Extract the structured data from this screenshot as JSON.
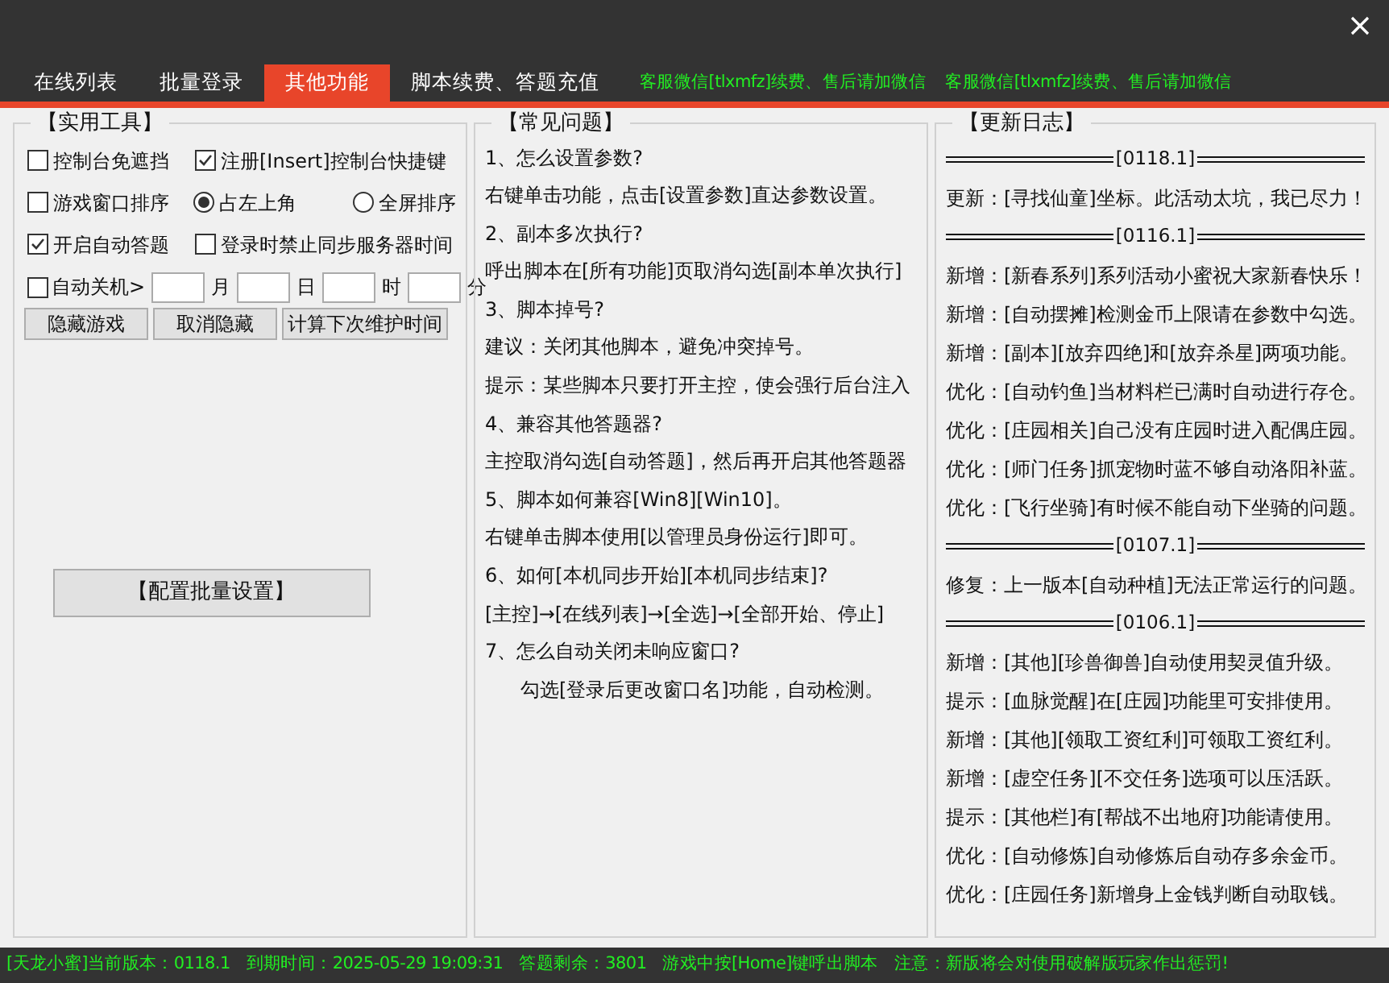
{
  "tabs": [
    {
      "label": "在线列表",
      "selected": false
    },
    {
      "label": "批量登录",
      "selected": false
    },
    {
      "label": "其他功能",
      "selected": true
    },
    {
      "label": "脚本续费、答题充值",
      "selected": false
    }
  ],
  "header_notes": [
    "客服微信[tlxmfz]续费、售后请加微信",
    "客服微信[tlxmfz]续费、售后请加微信"
  ],
  "tools": {
    "title": "【实用工具】",
    "options": [
      {
        "kind": "checkbox",
        "label": "控制台免遮挡",
        "checked": false
      },
      {
        "kind": "checkbox",
        "label": "注册[Insert]控制台快捷键",
        "checked": true
      },
      {
        "kind": "checkbox",
        "label": "游戏窗口排序",
        "checked": false
      },
      {
        "kind": "radio",
        "label": "占左上角",
        "selected": true
      },
      {
        "kind": "radio",
        "label": "全屏排序",
        "selected": false
      },
      {
        "kind": "checkbox",
        "label": "开启自动答题",
        "checked": true
      },
      {
        "kind": "checkbox",
        "label": "登录时禁止同步服务器时间",
        "checked": false
      }
    ],
    "shutdown": {
      "label": "自动关机>",
      "checked": false,
      "units": [
        "月",
        "日",
        "时",
        "分"
      ]
    },
    "buttons": [
      "隐藏游戏",
      "取消隐藏",
      "计算下次维护时间"
    ],
    "config_button": "【配置批量设置】"
  },
  "faq": {
    "title": "【常见问题】",
    "lines": [
      {
        "kind": "question",
        "text": "1、怎么设置参数?"
      },
      {
        "kind": "answer",
        "text": "右键单击功能，点击[设置参数]直达参数设置。"
      },
      {
        "kind": "question",
        "text": "2、副本多次执行?"
      },
      {
        "kind": "answer",
        "text": "呼出脚本在[所有功能]页取消勾选[副本单次执行]"
      },
      {
        "kind": "question",
        "text": "3、脚本掉号?"
      },
      {
        "kind": "answer",
        "text": "建议：关闭其他脚本，避免冲突掉号。"
      },
      {
        "kind": "answer",
        "text": "提示：某些脚本只要打开主控，使会强行后台注入"
      },
      {
        "kind": "question",
        "text": "4、兼容其他答题器?"
      },
      {
        "kind": "answer",
        "text": "主控取消勾选[自动答题]，然后再开启其他答题器"
      },
      {
        "kind": "question",
        "text": "5、脚本如何兼容[Win8][Win10]。"
      },
      {
        "kind": "answer",
        "text": "右键单击脚本使用[以管理员身份运行]即可。"
      },
      {
        "kind": "question",
        "text": "6、如何[本机同步开始][本机同步结束]?"
      },
      {
        "kind": "answer",
        "text": "[主控]→[在线列表]→[全选]→[全部开始、停止]"
      },
      {
        "kind": "question",
        "text": "7、怎么自动关闭未响应窗口?"
      },
      {
        "kind": "indented",
        "text": "勾选[登录后更改窗口名]功能，自动检测。"
      }
    ]
  },
  "changelog": {
    "title": "【更新日志】",
    "entries": [
      {
        "kind": "version",
        "text": "[0118.1]"
      },
      {
        "kind": "entry",
        "text": "更新：[寻找仙童]坐标。此活动太坑，我已尽力！"
      },
      {
        "kind": "version",
        "text": "[0116.1]"
      },
      {
        "kind": "entry",
        "text": "新增：[新春系列]系列活动小蜜祝大家新春快乐！"
      },
      {
        "kind": "entry",
        "text": "新增：[自动摆摊]检测金币上限请在参数中勾选。"
      },
      {
        "kind": "entry",
        "text": "新增：[副本][放弃四绝]和[放弃杀星]两项功能。"
      },
      {
        "kind": "entry",
        "text": "优化：[自动钓鱼]当材料栏已满时自动进行存仓。"
      },
      {
        "kind": "entry",
        "text": "优化：[庄园相关]自己没有庄园时进入配偶庄园。"
      },
      {
        "kind": "entry",
        "text": "优化：[师门任务]抓宠物时蓝不够自动洛阳补蓝。"
      },
      {
        "kind": "entry",
        "text": "优化：[飞行坐骑]有时候不能自动下坐骑的问题。"
      },
      {
        "kind": "version",
        "text": "[0107.1]"
      },
      {
        "kind": "entry",
        "text": "修复：上一版本[自动种植]无法正常运行的问题。"
      },
      {
        "kind": "version",
        "text": "[0106.1]"
      },
      {
        "kind": "entry",
        "text": "新增：[其他][珍兽御兽]自动使用契灵值升级。"
      },
      {
        "kind": "entry",
        "text": "提示：[血脉觉醒]在[庄园]功能里可安排使用。"
      },
      {
        "kind": "entry",
        "text": "新增：[其他][领取工资红利]可领取工资红利。"
      },
      {
        "kind": "entry",
        "text": "新增：[虚空任务][不交任务]选项可以压活跃。"
      },
      {
        "kind": "entry",
        "text": "提示：[其他栏]有[帮战不出地府]功能请使用。"
      },
      {
        "kind": "entry",
        "text": "优化：[自动修炼]自动修炼后自动存多余金币。"
      },
      {
        "kind": "entry",
        "text": "优化：[庄园任务]新增身上金钱判断自动取钱。"
      }
    ]
  },
  "status_bar": [
    "[天龙小蜜]当前版本：0118.1",
    "到期时间：2025-05-29 19:09:31",
    "答题剩余：3801",
    "游戏中按[Home]键呼出脚本",
    "注意：新版将会对使用破解版玩家作出惩罚!"
  ]
}
